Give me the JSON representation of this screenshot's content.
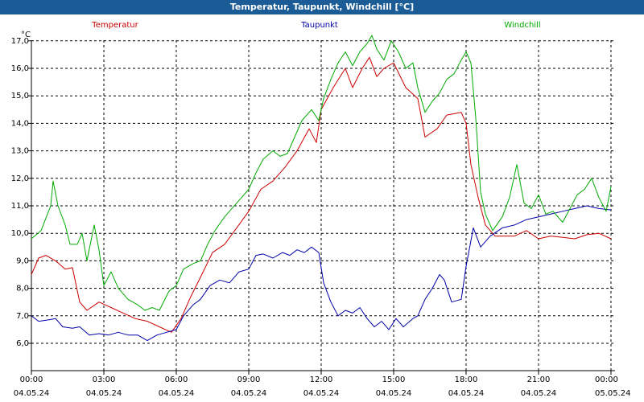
{
  "window": {
    "title": "Temperatur, Taupunkt, Windchill [°C]"
  },
  "chart_data": {
    "type": "line",
    "title": "Temperatur, Taupunkt, Windchill [°C]",
    "ylabel": "°C",
    "xlabel": "",
    "ylim": [
      5.5,
      17.7
    ],
    "xlim_hours": [
      0,
      24
    ],
    "grid": true,
    "legend": "top",
    "y_ticks": [
      "6,0",
      "7,0",
      "8,0",
      "9,0",
      "10,0",
      "11,0",
      "12,0",
      "13,0",
      "14,0",
      "15,0",
      "16,0",
      "17,0"
    ],
    "x_ticks": [
      {
        "time": "00:00",
        "date": "04.05.24"
      },
      {
        "time": "03:00",
        "date": "04.05.24"
      },
      {
        "time": "06:00",
        "date": "04.05.24"
      },
      {
        "time": "09:00",
        "date": "04.05.24"
      },
      {
        "time": "12:00",
        "date": "04.05.24"
      },
      {
        "time": "15:00",
        "date": "04.05.24"
      },
      {
        "time": "18:00",
        "date": "04.05.24"
      },
      {
        "time": "21:00",
        "date": "04.05.24"
      },
      {
        "time": "00:00",
        "date": "05.05.24"
      }
    ],
    "series": [
      {
        "name": "Temperatur",
        "color": "#cc0000",
        "points": [
          [
            0.0,
            8.5
          ],
          [
            0.3,
            9.1
          ],
          [
            0.6,
            9.2
          ],
          [
            1.0,
            9.0
          ],
          [
            1.4,
            8.7
          ],
          [
            1.7,
            8.75
          ],
          [
            2.0,
            7.5
          ],
          [
            2.3,
            7.2
          ],
          [
            2.8,
            7.5
          ],
          [
            3.3,
            7.3
          ],
          [
            3.8,
            7.1
          ],
          [
            4.3,
            6.9
          ],
          [
            4.8,
            6.8
          ],
          [
            5.3,
            6.6
          ],
          [
            5.8,
            6.4
          ],
          [
            6.2,
            6.9
          ],
          [
            6.6,
            7.7
          ],
          [
            7.0,
            8.4
          ],
          [
            7.5,
            9.3
          ],
          [
            8.0,
            9.6
          ],
          [
            8.5,
            10.2
          ],
          [
            9.0,
            10.8
          ],
          [
            9.5,
            11.6
          ],
          [
            10.0,
            11.9
          ],
          [
            10.5,
            12.4
          ],
          [
            11.0,
            13.0
          ],
          [
            11.5,
            13.8
          ],
          [
            11.8,
            13.3
          ],
          [
            12.0,
            14.5
          ],
          [
            12.5,
            15.3
          ],
          [
            13.0,
            16.0
          ],
          [
            13.3,
            15.3
          ],
          [
            13.7,
            16.0
          ],
          [
            14.0,
            16.4
          ],
          [
            14.3,
            15.7
          ],
          [
            14.6,
            16.0
          ],
          [
            15.0,
            16.2
          ],
          [
            15.5,
            15.3
          ],
          [
            16.0,
            14.9
          ],
          [
            16.3,
            13.5
          ],
          [
            16.8,
            13.8
          ],
          [
            17.2,
            14.3
          ],
          [
            17.8,
            14.4
          ],
          [
            18.0,
            14.0
          ],
          [
            18.2,
            12.5
          ],
          [
            18.5,
            11.3
          ],
          [
            18.8,
            10.3
          ],
          [
            19.2,
            9.9
          ],
          [
            19.5,
            9.9
          ],
          [
            20.0,
            9.9
          ],
          [
            20.5,
            10.1
          ],
          [
            21.0,
            9.8
          ],
          [
            21.5,
            9.9
          ],
          [
            22.0,
            9.85
          ],
          [
            22.5,
            9.8
          ],
          [
            23.0,
            9.95
          ],
          [
            23.5,
            10.0
          ],
          [
            24.0,
            9.8
          ]
        ]
      },
      {
        "name": "Taupunkt",
        "color": "#0000aa",
        "points": [
          [
            0.0,
            7.0
          ],
          [
            0.3,
            6.8
          ],
          [
            0.7,
            6.85
          ],
          [
            1.0,
            6.9
          ],
          [
            1.3,
            6.6
          ],
          [
            1.7,
            6.55
          ],
          [
            2.0,
            6.6
          ],
          [
            2.4,
            6.3
          ],
          [
            2.8,
            6.35
          ],
          [
            3.2,
            6.3
          ],
          [
            3.6,
            6.4
          ],
          [
            4.0,
            6.3
          ],
          [
            4.4,
            6.3
          ],
          [
            4.8,
            6.1
          ],
          [
            5.2,
            6.3
          ],
          [
            5.6,
            6.4
          ],
          [
            6.0,
            6.5
          ],
          [
            6.3,
            7.0
          ],
          [
            6.7,
            7.4
          ],
          [
            7.0,
            7.6
          ],
          [
            7.4,
            8.1
          ],
          [
            7.8,
            8.3
          ],
          [
            8.2,
            8.2
          ],
          [
            8.6,
            8.6
          ],
          [
            9.0,
            8.7
          ],
          [
            9.3,
            9.2
          ],
          [
            9.6,
            9.25
          ],
          [
            10.0,
            9.1
          ],
          [
            10.4,
            9.3
          ],
          [
            10.7,
            9.2
          ],
          [
            11.0,
            9.4
          ],
          [
            11.3,
            9.3
          ],
          [
            11.6,
            9.5
          ],
          [
            11.9,
            9.3
          ],
          [
            12.1,
            8.2
          ],
          [
            12.4,
            7.5
          ],
          [
            12.7,
            7.0
          ],
          [
            13.0,
            7.2
          ],
          [
            13.3,
            7.1
          ],
          [
            13.6,
            7.3
          ],
          [
            13.9,
            6.9
          ],
          [
            14.2,
            6.6
          ],
          [
            14.5,
            6.8
          ],
          [
            14.8,
            6.5
          ],
          [
            15.1,
            6.9
          ],
          [
            15.4,
            6.6
          ],
          [
            15.8,
            6.9
          ],
          [
            16.0,
            7.0
          ],
          [
            16.3,
            7.6
          ],
          [
            16.6,
            8.0
          ],
          [
            16.9,
            8.5
          ],
          [
            17.1,
            8.3
          ],
          [
            17.4,
            7.5
          ],
          [
            17.8,
            7.6
          ],
          [
            18.0,
            8.8
          ],
          [
            18.3,
            10.2
          ],
          [
            18.6,
            9.5
          ],
          [
            19.0,
            9.9
          ],
          [
            19.5,
            10.2
          ],
          [
            20.0,
            10.3
          ],
          [
            20.5,
            10.5
          ],
          [
            21.0,
            10.6
          ],
          [
            21.5,
            10.7
          ],
          [
            22.0,
            10.8
          ],
          [
            22.5,
            10.9
          ],
          [
            23.0,
            11.0
          ],
          [
            23.5,
            10.9
          ],
          [
            24.0,
            10.85
          ]
        ]
      },
      {
        "name": "Windchill",
        "color": "#00aa00",
        "points": [
          [
            0.0,
            9.8
          ],
          [
            0.4,
            10.1
          ],
          [
            0.8,
            11.0
          ],
          [
            0.9,
            11.9
          ],
          [
            1.1,
            11.0
          ],
          [
            1.4,
            10.3
          ],
          [
            1.6,
            9.6
          ],
          [
            1.9,
            9.6
          ],
          [
            2.1,
            10.0
          ],
          [
            2.3,
            9.0
          ],
          [
            2.6,
            10.3
          ],
          [
            2.8,
            9.4
          ],
          [
            3.0,
            8.1
          ],
          [
            3.3,
            8.6
          ],
          [
            3.6,
            8.0
          ],
          [
            4.0,
            7.6
          ],
          [
            4.4,
            7.4
          ],
          [
            4.7,
            7.2
          ],
          [
            5.0,
            7.3
          ],
          [
            5.3,
            7.2
          ],
          [
            5.7,
            7.9
          ],
          [
            6.0,
            8.1
          ],
          [
            6.3,
            8.7
          ],
          [
            6.7,
            8.9
          ],
          [
            7.0,
            9.0
          ],
          [
            7.3,
            9.6
          ],
          [
            7.6,
            10.1
          ],
          [
            8.0,
            10.6
          ],
          [
            8.3,
            10.9
          ],
          [
            8.6,
            11.2
          ],
          [
            9.0,
            11.6
          ],
          [
            9.3,
            12.2
          ],
          [
            9.6,
            12.7
          ],
          [
            10.0,
            13.0
          ],
          [
            10.3,
            12.8
          ],
          [
            10.6,
            12.9
          ],
          [
            10.9,
            13.5
          ],
          [
            11.2,
            14.1
          ],
          [
            11.6,
            14.5
          ],
          [
            11.9,
            14.1
          ],
          [
            12.1,
            14.9
          ],
          [
            12.4,
            15.6
          ],
          [
            12.7,
            16.2
          ],
          [
            13.0,
            16.6
          ],
          [
            13.3,
            16.1
          ],
          [
            13.6,
            16.6
          ],
          [
            13.9,
            16.9
          ],
          [
            14.1,
            17.2
          ],
          [
            14.3,
            16.7
          ],
          [
            14.6,
            16.3
          ],
          [
            14.9,
            17.0
          ],
          [
            15.2,
            16.6
          ],
          [
            15.5,
            16.0
          ],
          [
            15.8,
            16.2
          ],
          [
            16.0,
            15.3
          ],
          [
            16.3,
            14.4
          ],
          [
            16.6,
            14.8
          ],
          [
            16.9,
            15.1
          ],
          [
            17.2,
            15.6
          ],
          [
            17.5,
            15.8
          ],
          [
            17.8,
            16.3
          ],
          [
            18.0,
            16.6
          ],
          [
            18.2,
            16.2
          ],
          [
            18.4,
            14.2
          ],
          [
            18.6,
            11.5
          ],
          [
            18.8,
            10.7
          ],
          [
            19.1,
            10.1
          ],
          [
            19.5,
            10.6
          ],
          [
            19.8,
            11.3
          ],
          [
            20.1,
            12.5
          ],
          [
            20.4,
            11.1
          ],
          [
            20.7,
            10.9
          ],
          [
            21.0,
            11.4
          ],
          [
            21.3,
            10.7
          ],
          [
            21.6,
            10.8
          ],
          [
            22.0,
            10.4
          ],
          [
            22.3,
            10.9
          ],
          [
            22.6,
            11.4
          ],
          [
            22.9,
            11.6
          ],
          [
            23.2,
            12.0
          ],
          [
            23.5,
            11.3
          ],
          [
            23.8,
            10.8
          ],
          [
            24.0,
            11.7
          ]
        ]
      }
    ]
  }
}
